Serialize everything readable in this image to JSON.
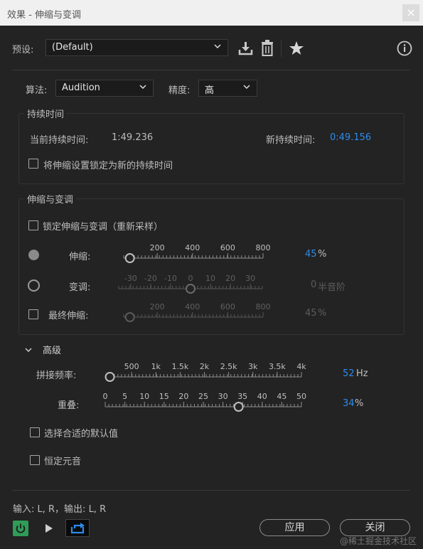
{
  "window": {
    "title": "效果 - 伸缩与变调",
    "close_glyph": "×"
  },
  "preset": {
    "label": "预设:",
    "value": "(Default)"
  },
  "toolbar_icons": [
    "download-icon",
    "trash-icon",
    "star-icon",
    "info-icon"
  ],
  "algorithm": {
    "label": "算法:",
    "value": "Audition"
  },
  "precision": {
    "label": "精度:",
    "value": "高"
  },
  "duration": {
    "group_label": "持续时间",
    "current_label": "当前持续时间:",
    "current_value": "1:49.236",
    "new_label": "新持续时间:",
    "new_value": "0:49.156",
    "lock_checkbox": "将伸缩设置锁定为新的持续时间"
  },
  "stretch_pitch": {
    "group_label": "伸缩与变调",
    "lock_checkbox": "锁定伸缩与变调（重新采样）",
    "stretch": {
      "label": "伸缩:",
      "ticks": [
        "200",
        "400",
        "600",
        "800"
      ],
      "value": "45",
      "unit": "%",
      "min": 10,
      "max": 800,
      "level": 45
    },
    "pitch": {
      "label": "变调:",
      "ticks": [
        "-30",
        "-20",
        "-10",
        "0",
        "10",
        "20",
        "30"
      ],
      "value": "0",
      "unit": "半音阶",
      "min": -36,
      "max": 36,
      "level": 0
    },
    "final_stretch": {
      "label": "最终伸缩:",
      "ticks": [
        "200",
        "400",
        "600",
        "800"
      ],
      "value": "45",
      "unit": "%",
      "min": 10,
      "max": 800,
      "level": 45
    }
  },
  "advanced": {
    "toggle_label": "高级",
    "splice": {
      "label": "拼接频率:",
      "ticks": [
        "500",
        "1k",
        "1.5k",
        "2k",
        "2.5k",
        "3k",
        "3.5k",
        "4k"
      ],
      "value": "52",
      "unit": "Hz",
      "min": 0,
      "max": 4000,
      "level": 52
    },
    "overlap": {
      "label": "重叠:",
      "ticks": [
        "0",
        "5",
        "10",
        "15",
        "20",
        "25",
        "30",
        "35",
        "40",
        "45",
        "50"
      ],
      "value": "34",
      "unit": "%",
      "min": 0,
      "max": 50,
      "level": 34
    },
    "default_checkbox": "选择合适的默认值",
    "formant_checkbox": "恒定元音"
  },
  "io_text": "输入: L, R，输出: L, R",
  "buttons": {
    "apply": "应用",
    "close": "关闭"
  },
  "watermark": "@稀土掘金技术社区",
  "colors": {
    "accent": "#2d8ceb",
    "power": "#2f9c57"
  }
}
